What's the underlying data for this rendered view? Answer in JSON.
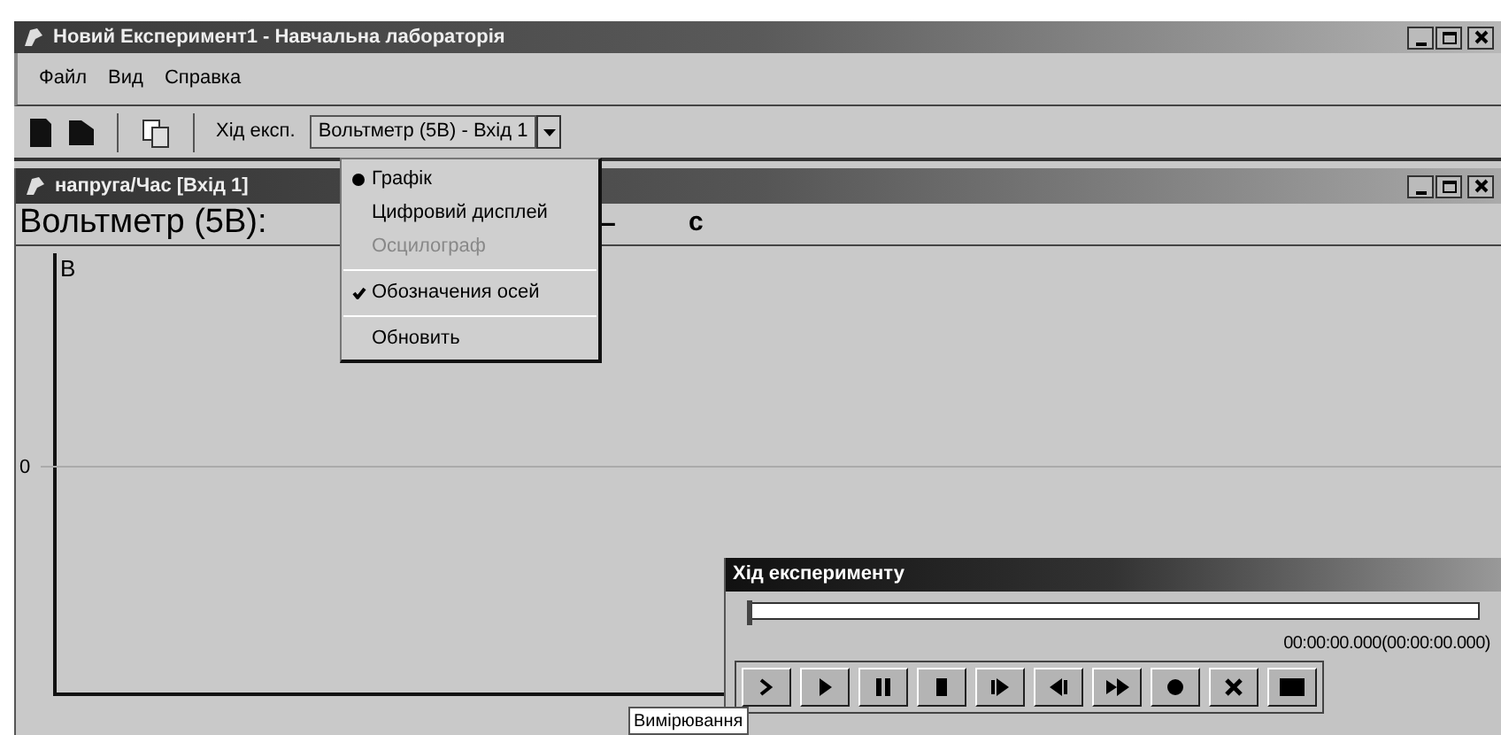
{
  "window": {
    "title": "Новий Експеримент1 - Навчальна лабораторія"
  },
  "menu_bar": [
    "Файл",
    "Вид",
    "Справка"
  ],
  "toolbar": {
    "experiment_label": "Хід експ.",
    "experiment_select": "Вольтметр (5В) - Вхід 1"
  },
  "child_window": {
    "title": "напруга/Час [Вхід 1]",
    "heading": "Вольтметр (5В):",
    "heading_values": [
      "–",
      "c"
    ],
    "y_axis_label": "В",
    "y_ticks": [
      "0"
    ]
  },
  "dropdown_menu": [
    {
      "kind": "radio",
      "label": "Графік",
      "selected": true,
      "disabled": false
    },
    {
      "kind": "radio",
      "label": "Цифровий дисплей",
      "selected": false,
      "disabled": false
    },
    {
      "kind": "radio",
      "label": "Осцилограф",
      "selected": false,
      "disabled": true
    },
    {
      "kind": "separator"
    },
    {
      "kind": "check",
      "label": "Обозначения осей",
      "checked": true
    },
    {
      "kind": "separator"
    },
    {
      "kind": "command",
      "label": "Обновить"
    }
  ],
  "progress_panel": {
    "title": "Хід експерименту",
    "level": 0,
    "time": "00:00:00.000(00:00:00.000)",
    "buttons": [
      {
        "kind": "measure"
      },
      {
        "kind": "play"
      },
      {
        "kind": "pause"
      },
      {
        "kind": "stop"
      },
      {
        "kind": "step-forward"
      },
      {
        "kind": "step-back"
      },
      {
        "kind": "fast-forward"
      },
      {
        "kind": "record"
      },
      {
        "kind": "delete"
      },
      {
        "kind": "screen"
      }
    ]
  },
  "tooltip": "Вимірювання"
}
